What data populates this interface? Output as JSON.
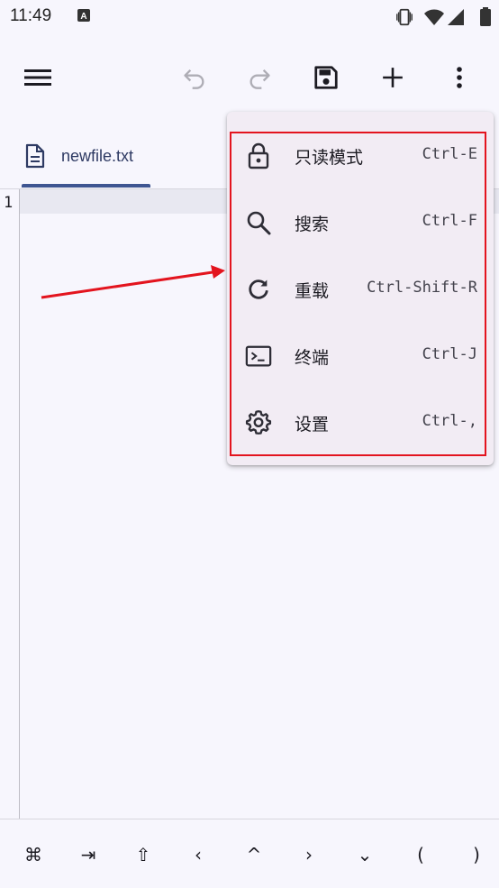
{
  "status_bar": {
    "time": "11:49"
  },
  "toolbar": {
    "icons": [
      "menu-icon",
      "undo-icon",
      "redo-icon",
      "save-icon",
      "add-icon",
      "more-vert-icon"
    ]
  },
  "tab": {
    "filename": "newfile.txt",
    "active": true
  },
  "editor": {
    "line_numbers": [
      "1"
    ]
  },
  "menu": {
    "items": [
      {
        "label": "只读模式",
        "shortcut": "Ctrl-E",
        "icon": "lock-icon"
      },
      {
        "label": "搜索",
        "shortcut": "Ctrl-F",
        "icon": "search-icon"
      },
      {
        "label": "重载",
        "shortcut": "Ctrl-Shift-R",
        "icon": "reload-icon"
      },
      {
        "label": "终端",
        "shortcut": "Ctrl-J",
        "icon": "terminal-icon"
      },
      {
        "label": "设置",
        "shortcut": "Ctrl-,",
        "icon": "settings-icon"
      }
    ]
  },
  "keybar": {
    "keys": [
      "⌘",
      "⇥",
      "⇧",
      "‹",
      "^",
      "›",
      "⌄",
      "(",
      ")"
    ]
  },
  "colors": {
    "accent": "#3e5591",
    "annotation": "#e3141e",
    "menu_background": "#f2ecf4",
    "page_background": "#f7f6fd"
  }
}
